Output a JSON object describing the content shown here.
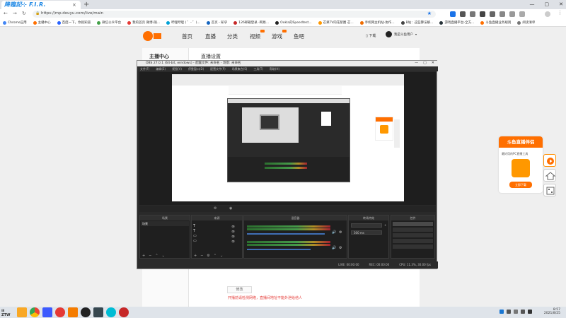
{
  "browser": {
    "tab_title": "降臨記⊹ F.I.R.",
    "url": "https://mp.douyu.com/live/main",
    "bookmarks": [
      {
        "label": "Chrome应用",
        "color": "#4285f4"
      },
      {
        "label": "主播中心",
        "color": "#ff6f00"
      },
      {
        "label": "百度一下，你就知道",
        "color": "#2962ff"
      },
      {
        "label": "微信公众平台",
        "color": "#43a047"
      },
      {
        "label": "我的首页 微博-随...",
        "color": "#e53935"
      },
      {
        "label": "哔哩哔哩 ( ゜- ゜)...",
        "color": "#00a1d6"
      },
      {
        "label": "首页 - 知乎",
        "color": "#1565c0"
      },
      {
        "label": "126邮箱登录 -网易...",
        "color": "#c62828"
      },
      {
        "label": "Ookla的Speedtest...",
        "color": "#212121"
      },
      {
        "label": "芒果TV的花絮圈 芒...",
        "color": "#ff9800"
      },
      {
        "label": "手机网主机站-协作...",
        "color": "#ef6c00"
      },
      {
        "label": "B站：这些算法解...",
        "color": "#424242"
      },
      {
        "label": "游戏直播平台-全方...",
        "color": "#263238"
      },
      {
        "label": "斗鱼直播业务规则",
        "color": "#ff6f00"
      },
      {
        "label": "阅读清单",
        "color": "#757575"
      }
    ]
  },
  "site": {
    "nav": [
      "首页",
      "直播",
      "分类",
      "视频",
      "游戏",
      "鱼吧"
    ],
    "download_label": "下载",
    "username": "我是斗鱼用户",
    "side_title": "主播中心",
    "main_title": "直播设置",
    "edit_button": "修改",
    "warning": "开播前请检测网络，直播间地址不能外泄给他人"
  },
  "ad": {
    "header": "斗鱼直播伴侣",
    "subtitle": "最好用的PC直播工具",
    "button": "立即下载"
  },
  "obs": {
    "title": "OBS 27.0.1 (64-bit, windows) - 配置文件: 未命名 - 场景: 未命名",
    "menu": [
      "文件(F)",
      "编辑(E)",
      "视图(V)",
      "停靠窗口(D)",
      "配置文件(P)",
      "场景集合(S)",
      "工具(T)",
      "帮助(H)"
    ],
    "docks": [
      "场景",
      "来源",
      "混音器",
      "转场特效",
      "控件"
    ],
    "scene_item": "场景",
    "transition": "300 ms",
    "status": [
      "LIVE: 00:00:00",
      "REC: 00:00:00",
      "CPU: 11.3%, 30.00 fps"
    ]
  },
  "taskbar": {
    "time": "8:57",
    "date": "2021/8/25"
  }
}
